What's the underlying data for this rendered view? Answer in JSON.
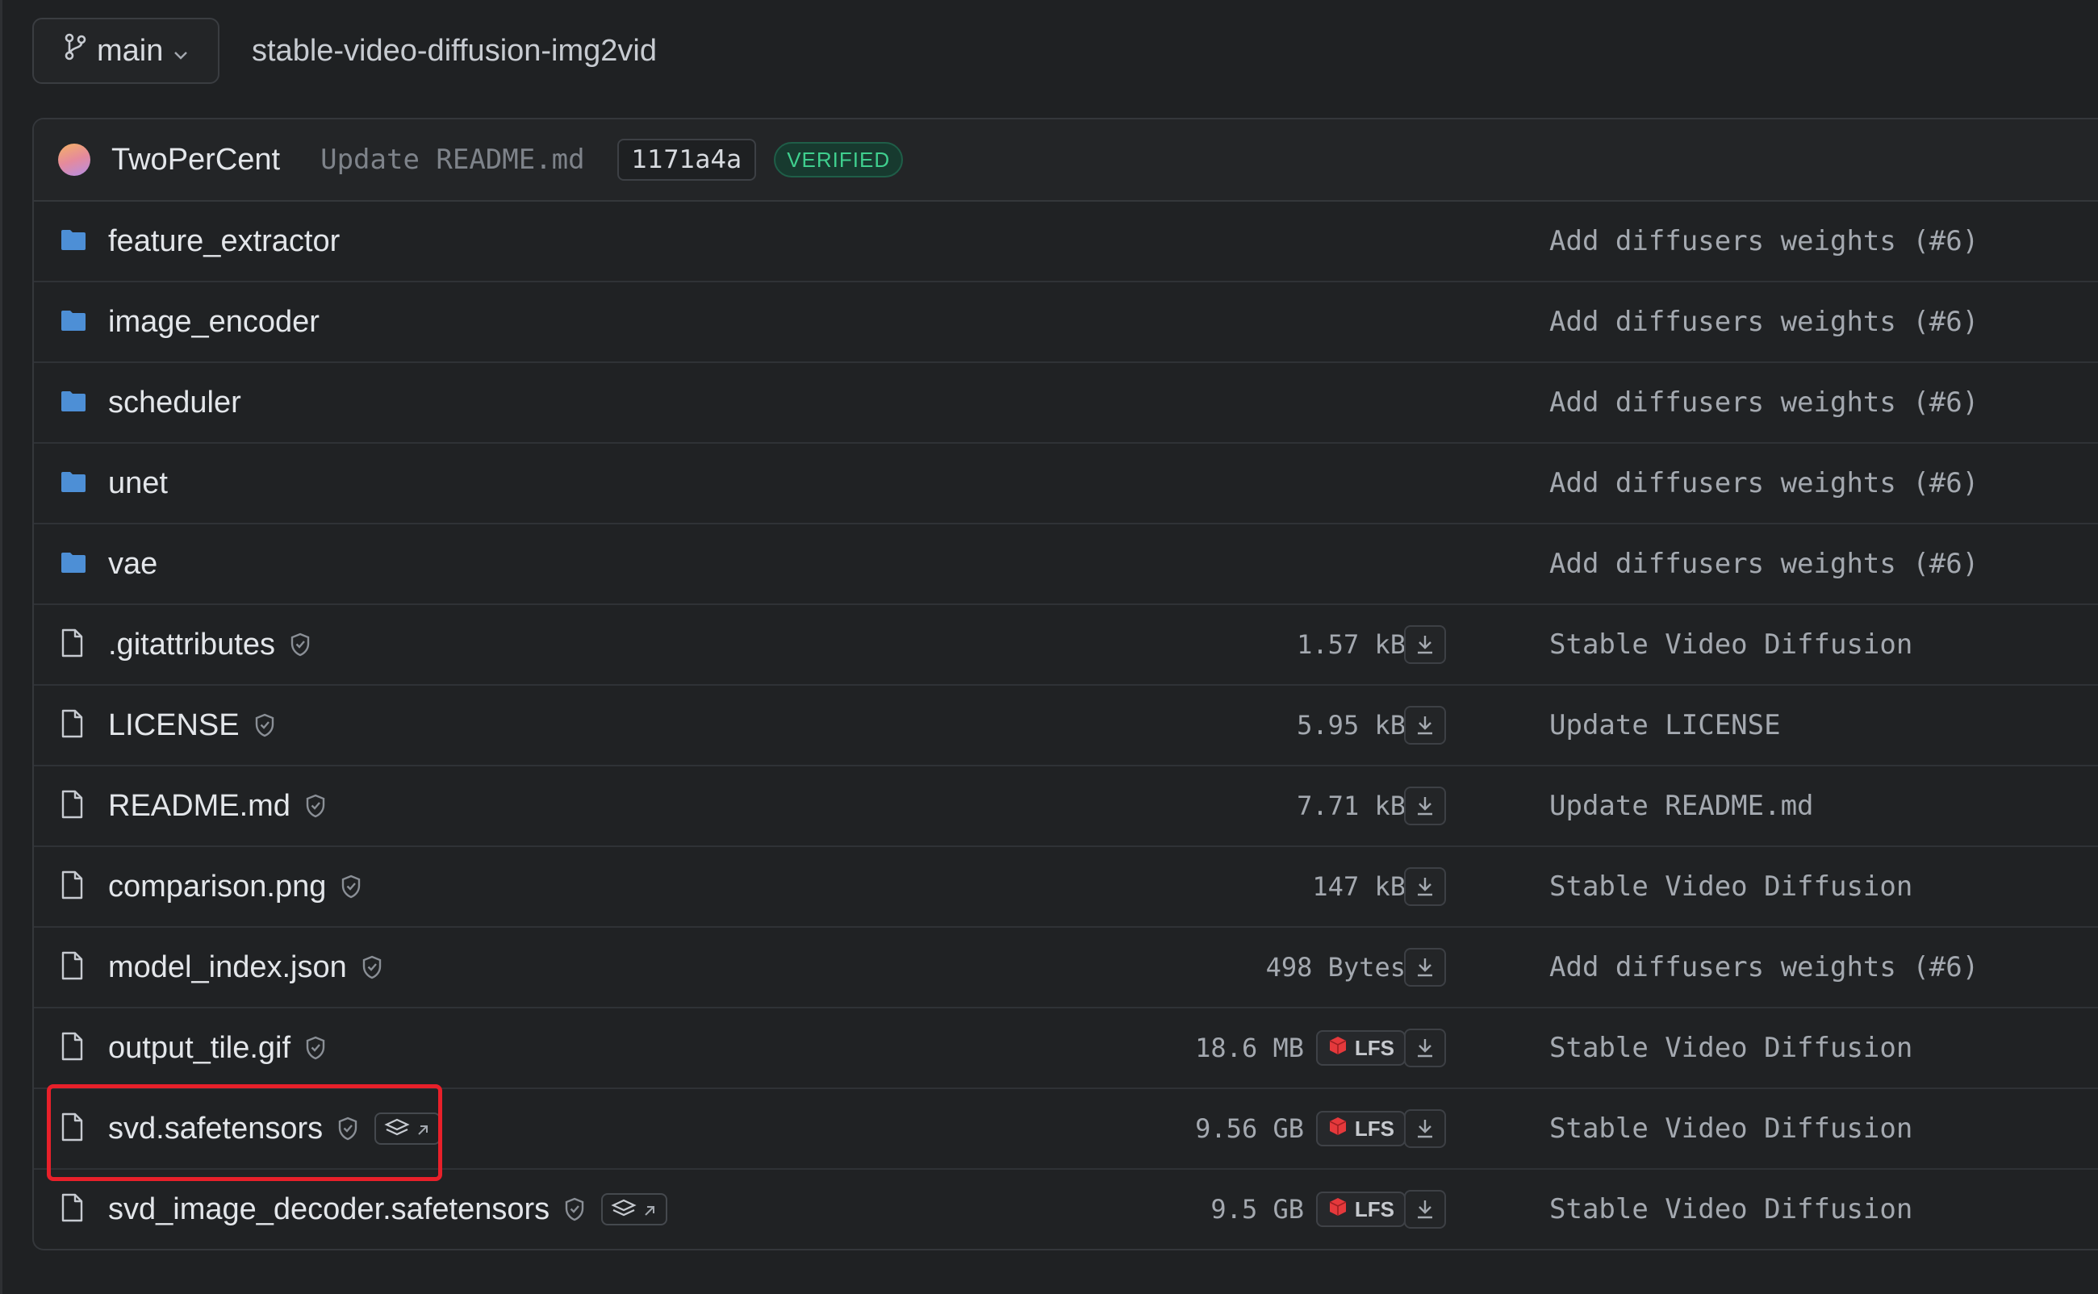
{
  "branch": {
    "name": "main",
    "repo_path": "stable-video-diffusion-img2vid"
  },
  "commit": {
    "author": "TwoPerCent",
    "message": "Update README.md",
    "sha": "1171a4a",
    "verified_label": "VERIFIED"
  },
  "colors": {
    "folder": "#4d8fd6",
    "verified": "#3fcf8e",
    "lfs_red": "#e5393c",
    "highlight": "#e8202a"
  },
  "rows": [
    {
      "type": "folder",
      "name": "feature_extractor",
      "last_commit": "Add diffusers weights (#6)"
    },
    {
      "type": "folder",
      "name": "image_encoder",
      "last_commit": "Add diffusers weights (#6)"
    },
    {
      "type": "folder",
      "name": "scheduler",
      "last_commit": "Add diffusers weights (#6)"
    },
    {
      "type": "folder",
      "name": "unet",
      "last_commit": "Add diffusers weights (#6)"
    },
    {
      "type": "folder",
      "name": "vae",
      "last_commit": "Add diffusers weights (#6)"
    },
    {
      "type": "file",
      "name": ".gitattributes",
      "size": "1.57 kB",
      "last_commit": "Stable Video Diffusion"
    },
    {
      "type": "file",
      "name": "LICENSE",
      "size": "5.95 kB",
      "last_commit": "Update LICENSE"
    },
    {
      "type": "file",
      "name": "README.md",
      "size": "7.71 kB",
      "last_commit": "Update README.md"
    },
    {
      "type": "file",
      "name": "comparison.png",
      "size": "147 kB",
      "last_commit": "Stable Video Diffusion"
    },
    {
      "type": "file",
      "name": "model_index.json",
      "size": "498 Bytes",
      "last_commit": "Add diffusers weights (#6)"
    },
    {
      "type": "file",
      "name": "output_tile.gif",
      "size": "18.6 MB",
      "lfs_label": "LFS",
      "last_commit": "Stable Video Diffusion"
    },
    {
      "type": "file",
      "name": "svd.safetensors",
      "size": "9.56 GB",
      "lfs_label": "LFS",
      "last_commit": "Stable Video Diffusion"
    },
    {
      "type": "file",
      "name": "svd_image_decoder.safetensors",
      "size": "9.5 GB",
      "lfs_label": "LFS",
      "last_commit": "Stable Video Diffusion"
    }
  ]
}
